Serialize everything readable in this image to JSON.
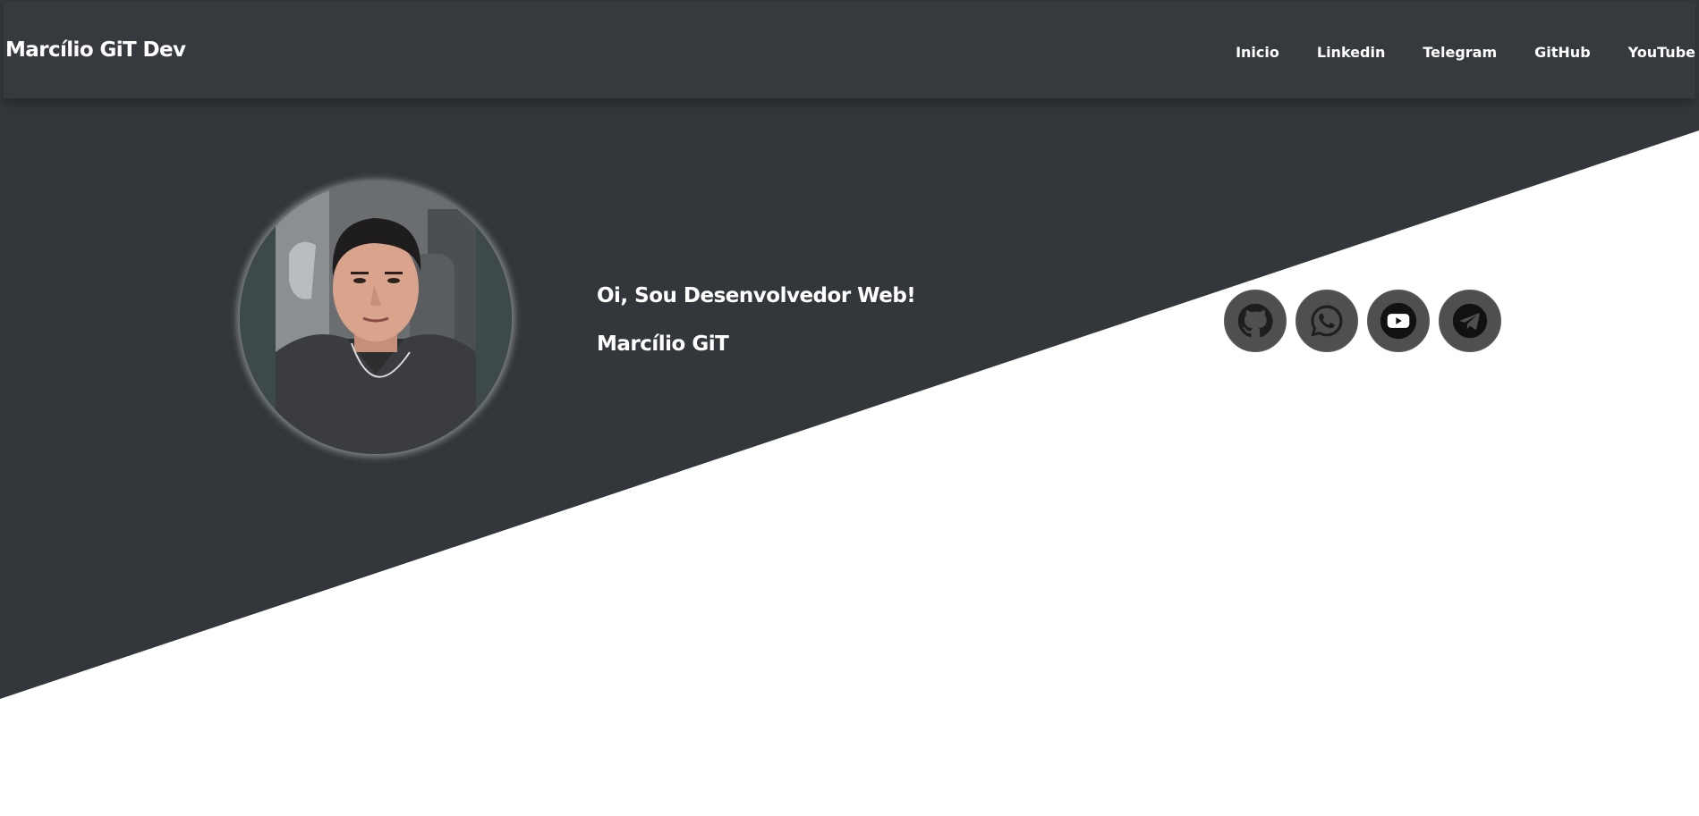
{
  "header": {
    "brand": "Marcílio GiT Dev",
    "nav": [
      {
        "label": "Inicio"
      },
      {
        "label": "Linkedin"
      },
      {
        "label": "Telegram"
      },
      {
        "label": "GitHub"
      },
      {
        "label": "YouTube"
      }
    ]
  },
  "hero": {
    "greeting": "Oi, Sou Desenvolvedor Web!",
    "name": "Marcílio GiT"
  },
  "social": [
    {
      "icon": "github-icon"
    },
    {
      "icon": "whatsapp-icon"
    },
    {
      "icon": "youtube-icon"
    },
    {
      "icon": "telegram-icon"
    }
  ],
  "colors": {
    "dark_bg": "#33373b",
    "navbar_bg": "#363a3f",
    "social_button_bg": "#4f4f4f",
    "text": "#ffffff"
  }
}
